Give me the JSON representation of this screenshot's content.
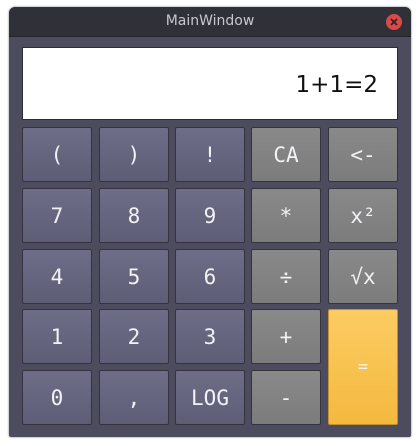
{
  "window": {
    "title": "MainWindow"
  },
  "display": {
    "expression": "1+1=2"
  },
  "colors": {
    "key": "#65647d",
    "operator": "#838383",
    "equals": "#f8c34f",
    "window": "#4d4c5e",
    "titlebar": "#303038",
    "close": "#d94a4a"
  },
  "icons": {
    "close": "close-icon"
  },
  "keys": {
    "open_paren": "(",
    "close_paren": ")",
    "factorial": "!",
    "clear_all": "CA",
    "backspace": "<-",
    "seven": "7",
    "eight": "8",
    "nine": "9",
    "multiply": "*",
    "square": "x²",
    "four": "4",
    "five": "5",
    "six": "6",
    "divide": "÷",
    "sqrt": "√x",
    "one": "1",
    "two": "2",
    "three": "3",
    "plus": "+",
    "equals": "=",
    "zero": "0",
    "comma": ",",
    "log": "LOG",
    "minus": "-"
  }
}
